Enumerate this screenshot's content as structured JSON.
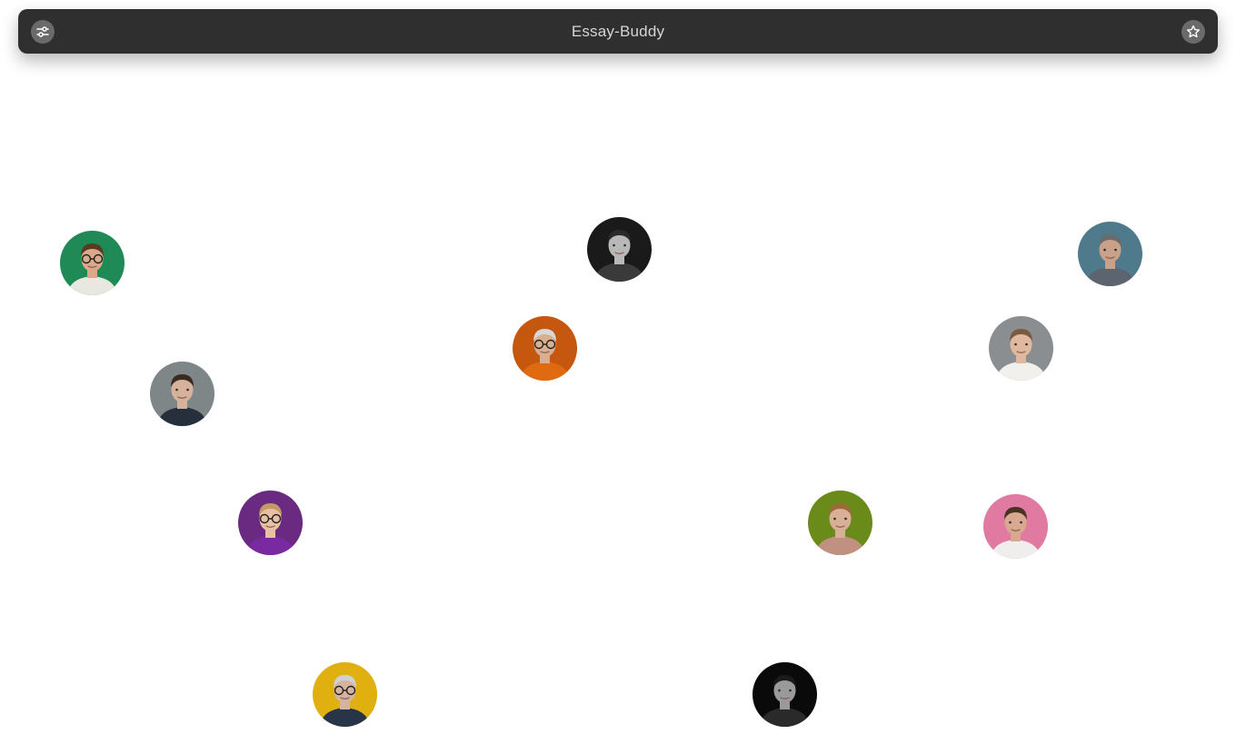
{
  "header": {
    "title": "Essay-Buddy",
    "left_icon": "sliders-icon",
    "right_icon": "star-icon",
    "bar_color": "#2f2f2f"
  },
  "avatars": [
    {
      "icon": "person-avatar",
      "bg": "#1f8a55",
      "skin": "#d9a98a",
      "hair": "#5a3a22",
      "shirt": "#e8e8e0",
      "glasses": true
    },
    {
      "icon": "person-avatar",
      "bg": "#1a1a1a",
      "skin": "#b8b8b8",
      "hair": "#2a2a2a",
      "shirt": "#3a3a3a",
      "glasses": false
    },
    {
      "icon": "person-avatar",
      "bg": "#4f7a8c",
      "skin": "#c9a088",
      "hair": "#6b6b6b",
      "shirt": "#5c6470",
      "glasses": false
    },
    {
      "icon": "person-avatar",
      "bg": "#c5570f",
      "skin": "#d8b090",
      "hair": "#d8d8d8",
      "shirt": "#e06a10",
      "glasses": true
    },
    {
      "icon": "person-avatar",
      "bg": "#8a8e90",
      "skin": "#e0b8a0",
      "hair": "#7a5a40",
      "shirt": "#f2f0ec",
      "glasses": false
    },
    {
      "icon": "person-avatar",
      "bg": "#7e8688",
      "skin": "#d6b29c",
      "hair": "#3a2a20",
      "shirt": "#26303c",
      "glasses": false
    },
    {
      "icon": "person-avatar",
      "bg": "#6a2a82",
      "skin": "#e8c0a4",
      "hair": "#c49a64",
      "shirt": "#7a2aa0",
      "glasses": true
    },
    {
      "icon": "person-avatar",
      "bg": "#6a8a1a",
      "skin": "#d8b096",
      "hair": "#9a6a3a",
      "shirt": "#c09080",
      "glasses": false
    },
    {
      "icon": "person-avatar",
      "bg": "#e07aa0",
      "skin": "#d8a890",
      "hair": "#4a3222",
      "shirt": "#f0eeec",
      "glasses": false
    },
    {
      "icon": "person-avatar",
      "bg": "#e0b010",
      "skin": "#d4b4a0",
      "hair": "#d0d0d0",
      "shirt": "#283448",
      "glasses": true
    },
    {
      "icon": "person-avatar",
      "bg": "#0a0a0a",
      "skin": "#9a9a9a",
      "hair": "#1a1a1a",
      "shirt": "#2a2a2a",
      "glasses": false
    }
  ]
}
